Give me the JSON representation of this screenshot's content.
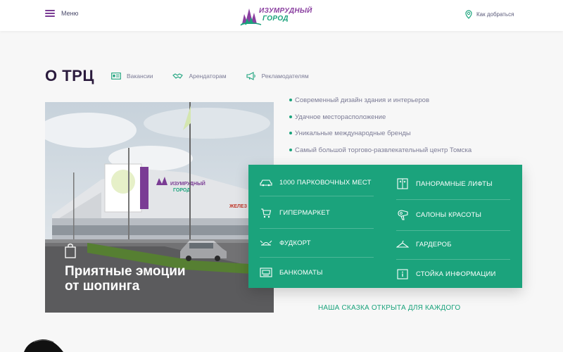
{
  "header": {
    "menu_label": "Меню",
    "logo_line1": "ИЗУМРУДНЫЙ",
    "logo_line2": "ГОРОД",
    "directions_label": "Как добраться"
  },
  "section": {
    "title": "О ТРЦ",
    "links": [
      {
        "label": "Вакансии",
        "icon": "id-card-icon"
      },
      {
        "label": "Арендаторам",
        "icon": "handshake-icon"
      },
      {
        "label": "Рекламодателям",
        "icon": "megaphone-icon"
      }
    ]
  },
  "photo": {
    "caption_line1": "Приятные эмоции",
    "caption_line2": "от шопинга",
    "building_sign_line1": "ИЗУМРУДНЫЙ",
    "building_sign_line2": "ГОРОД",
    "store_sign": "ЖЕЛЕЗ"
  },
  "bullets": [
    "Современный дизайн здания и интерьеров",
    "Удачное месторасположение",
    "Уникальные международные бренды",
    "Самый большой торгово-развлекательный центр Томска"
  ],
  "features": {
    "left": [
      {
        "label": "1000 ПАРКОВОЧНЫХ МЕСТ",
        "icon": "car-icon"
      },
      {
        "label": "ГИПЕРМАРКЕТ",
        "icon": "cart-icon"
      },
      {
        "label": "ФУДКОРТ",
        "icon": "tray-icon"
      },
      {
        "label": "БАНКОМАТЫ",
        "icon": "atm-icon"
      }
    ],
    "right": [
      {
        "label": "ПАНОРАМНЫЕ ЛИФТЫ",
        "icon": "elevator-icon"
      },
      {
        "label": "САЛОНЫ КРАСОТЫ",
        "icon": "hairdryer-icon"
      },
      {
        "label": "ГАРДЕРОБ",
        "icon": "hanger-icon"
      },
      {
        "label": "СТОЙКА ИНФОРМАЦИИ",
        "icon": "info-desk-icon"
      }
    ]
  },
  "tagline": "НАША СКАЗКА ОТКРЫТА ДЛЯ КАЖДОГО",
  "colors": {
    "accent_green": "#1ba37c",
    "accent_purple": "#7a3c94",
    "title_dark": "#2b1b3d"
  }
}
